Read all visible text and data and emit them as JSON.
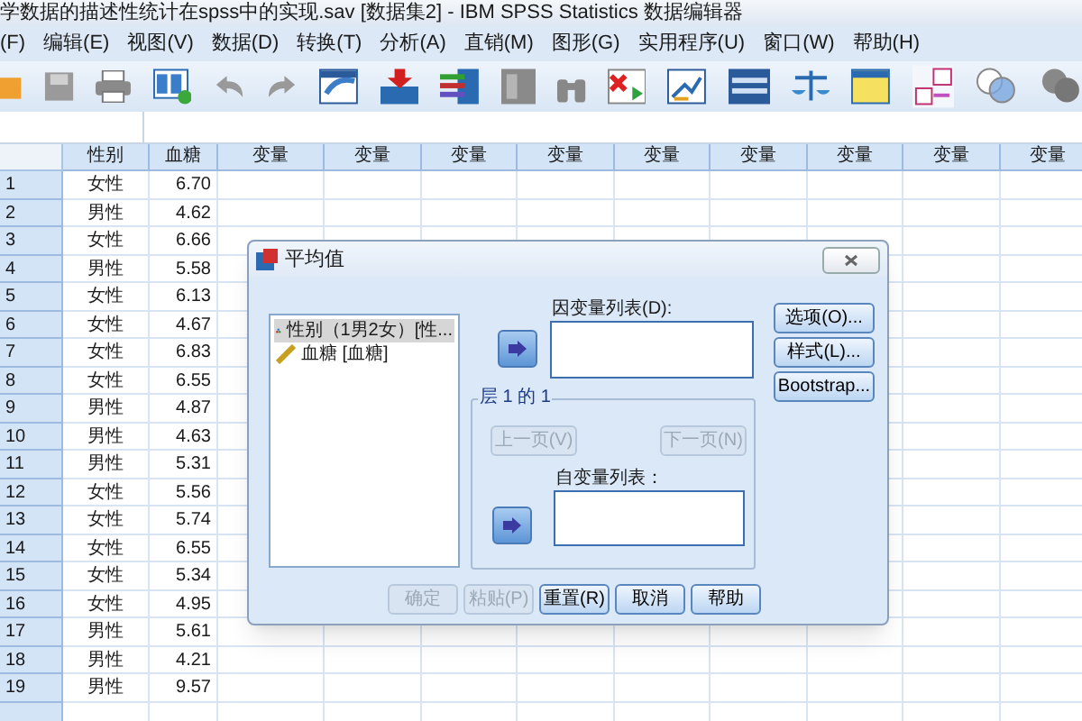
{
  "window": {
    "title": "学数据的描述性统计在spss中的实现.sav [数据集2] - IBM SPSS Statistics 数据编辑器"
  },
  "menu": [
    "(F)",
    "编辑(E)",
    "视图(V)",
    "数据(D)",
    "转换(T)",
    "分析(A)",
    "直销(M)",
    "图形(G)",
    "实用程序(U)",
    "窗口(W)",
    "帮助(H)"
  ],
  "grid": {
    "columns": [
      "性别",
      "血糖",
      "变量",
      "变量",
      "变量",
      "变量",
      "变量",
      "变量",
      "变量",
      "变量",
      "变量"
    ],
    "rows": [
      {
        "number": "1",
        "cells": [
          "女性",
          "6.70"
        ]
      },
      {
        "number": "2",
        "cells": [
          "男性",
          "4.62"
        ]
      },
      {
        "number": "3",
        "cells": [
          "女性",
          "6.66"
        ]
      },
      {
        "number": "4",
        "cells": [
          "男性",
          "5.58"
        ]
      },
      {
        "number": "5",
        "cells": [
          "女性",
          "6.13"
        ]
      },
      {
        "number": "6",
        "cells": [
          "女性",
          "4.67"
        ]
      },
      {
        "number": "7",
        "cells": [
          "女性",
          "6.83"
        ]
      },
      {
        "number": "8",
        "cells": [
          "女性",
          "6.55"
        ]
      },
      {
        "number": "9",
        "cells": [
          "男性",
          "4.87"
        ]
      },
      {
        "number": "10",
        "cells": [
          "男性",
          "4.63"
        ]
      },
      {
        "number": "11",
        "cells": [
          "男性",
          "5.31"
        ]
      },
      {
        "number": "12",
        "cells": [
          "女性",
          "5.56"
        ]
      },
      {
        "number": "13",
        "cells": [
          "女性",
          "5.74"
        ]
      },
      {
        "number": "14",
        "cells": [
          "女性",
          "6.55"
        ]
      },
      {
        "number": "15",
        "cells": [
          "女性",
          "5.34"
        ]
      },
      {
        "number": "16",
        "cells": [
          "女性",
          "4.95"
        ]
      },
      {
        "number": "17",
        "cells": [
          "男性",
          "5.61"
        ]
      },
      {
        "number": "18",
        "cells": [
          "男性",
          "4.21"
        ]
      },
      {
        "number": "19",
        "cells": [
          "男性",
          "9.57"
        ]
      }
    ]
  },
  "dialog": {
    "title": "平均值",
    "variables": [
      {
        "label": "性别（1男2女）[性...",
        "kind": "nominal",
        "selected": true
      },
      {
        "label": "血糖 [血糖]",
        "kind": "scale",
        "selected": false
      }
    ],
    "dependent_label": "因变量列表(D):",
    "layer_title": "层 1 的 1",
    "prev_button": {
      "label": "上一页(V)",
      "disabled": true
    },
    "next_button": {
      "label": "下一页(N)",
      "disabled": true
    },
    "independent_label": "自变量列表：",
    "side_buttons": [
      {
        "label": "选项(O)...",
        "disabled": false
      },
      {
        "label": "样式(L)...",
        "disabled": false
      },
      {
        "label": "Bootstrap...",
        "disabled": false
      }
    ],
    "bottom_buttons": [
      {
        "label": "确定",
        "disabled": true
      },
      {
        "label": "粘贴(P)",
        "disabled": true
      },
      {
        "label": "重置(R)",
        "disabled": false
      },
      {
        "label": "取消",
        "disabled": false
      },
      {
        "label": "帮助",
        "disabled": false
      }
    ]
  }
}
